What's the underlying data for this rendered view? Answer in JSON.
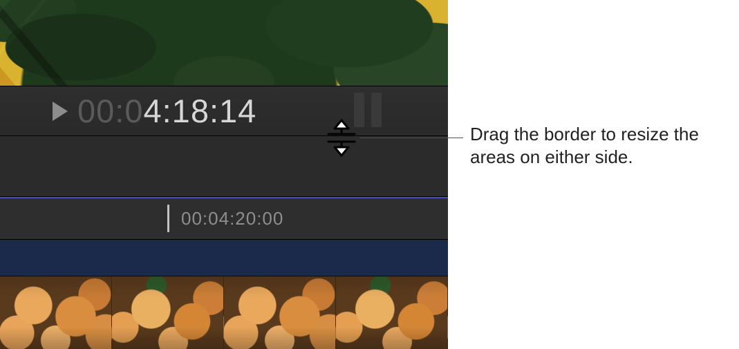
{
  "toolbar": {
    "timecode_dim": "00:0",
    "timecode_bright": "4:18:14"
  },
  "ruler": {
    "timecode": "00:04:20:00"
  },
  "callout": {
    "text": "Drag the border to resize the areas on either side."
  }
}
